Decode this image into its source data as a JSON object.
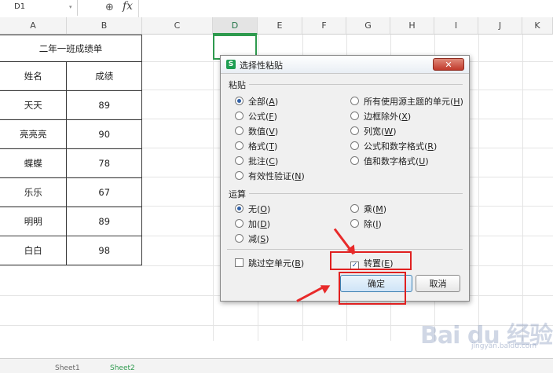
{
  "formula_bar": {
    "name_box": "D1",
    "name_box_arrow": "▾",
    "zoom_icon": "⊕",
    "fx": "fx"
  },
  "columns": [
    "A",
    "B",
    "C",
    "D",
    "E",
    "F",
    "G",
    "H",
    "I",
    "J",
    "K"
  ],
  "sheet_table": {
    "title": "二年一班成绩单",
    "headers": [
      "姓名",
      "成绩"
    ],
    "rows": [
      [
        "天天",
        "89"
      ],
      [
        "亮亮亮",
        "90"
      ],
      [
        "蝶蝶",
        "78"
      ],
      [
        "乐乐",
        "67"
      ],
      [
        "明明",
        "89"
      ],
      [
        "白白",
        "98"
      ]
    ]
  },
  "dialog": {
    "logo": "S",
    "title": "选择性粘贴",
    "close": "✕",
    "paste_group": "粘贴",
    "paste_options_left": [
      {
        "label": "全部(",
        "key": "A",
        "end": ")",
        "selected": true
      },
      {
        "label": "公式(",
        "key": "F",
        "end": ")",
        "selected": false
      },
      {
        "label": "数值(",
        "key": "V",
        "end": ")",
        "selected": false
      },
      {
        "label": "格式(",
        "key": "T",
        "end": ")",
        "selected": false
      },
      {
        "label": "批注(",
        "key": "C",
        "end": ")",
        "selected": false
      },
      {
        "label": "有效性验证(",
        "key": "N",
        "end": ")",
        "selected": false
      }
    ],
    "paste_options_right": [
      {
        "label": "所有使用源主题的单元(",
        "key": "H",
        "end": ")"
      },
      {
        "label": "边框除外(",
        "key": "X",
        "end": ")"
      },
      {
        "label": "列宽(",
        "key": "W",
        "end": ")"
      },
      {
        "label": "公式和数字格式(",
        "key": "R",
        "end": ")"
      },
      {
        "label": "值和数字格式(",
        "key": "U",
        "end": ")"
      }
    ],
    "operation_group": "运算",
    "operation_left": [
      {
        "label": "无(",
        "key": "O",
        "end": ")",
        "selected": true
      },
      {
        "label": "加(",
        "key": "D",
        "end": ")",
        "selected": false
      },
      {
        "label": "减(",
        "key": "S",
        "end": ")",
        "selected": false
      }
    ],
    "operation_right": [
      {
        "label": "乘(",
        "key": "M",
        "end": ")"
      },
      {
        "label": "除(",
        "key": "I",
        "end": ")"
      }
    ],
    "skip_blanks": {
      "label": "跳过空单元(",
      "key": "B",
      "end": ")",
      "checked": false
    },
    "transpose": {
      "label": "转置(",
      "key": "E",
      "end": ")",
      "checked": true,
      "mark": "✓"
    },
    "ok": "确定",
    "cancel": "取消"
  },
  "sheet_tabs": [
    "Sheet1",
    "Sheet2"
  ],
  "watermark": {
    "main": "Bai du 经验",
    "sub": "jingyan.baidu.com"
  },
  "colors": {
    "accent": "#2e9a4e",
    "annotation": "#e02020"
  }
}
